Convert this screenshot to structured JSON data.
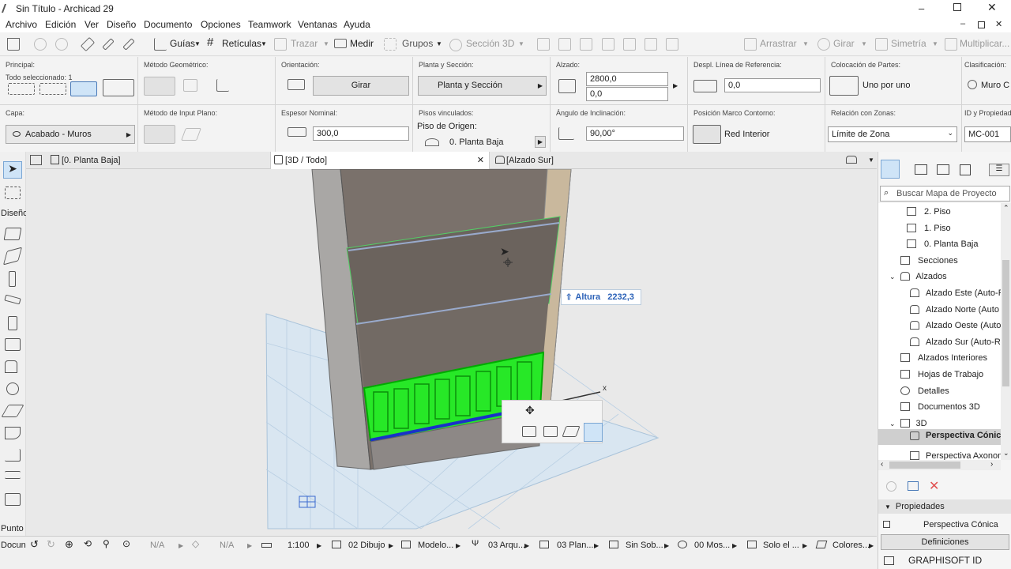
{
  "window": {
    "title": "Sin Título - Archicad 29"
  },
  "menu": [
    "Archivo",
    "Edición",
    "Ver",
    "Diseño",
    "Documento",
    "Opciones",
    "Teamwork",
    "Ventanas",
    "Ayuda"
  ],
  "toolbar": {
    "guias": "Guías",
    "reticulas": "Retículas",
    "trazar": "Trazar",
    "medir": "Medir",
    "grupos": "Grupos",
    "seccion3d": "Sección 3D",
    "arrastrar": "Arrastrar",
    "girar": "Girar",
    "simetria": "Simetría",
    "multiplicar": "Multiplicar..."
  },
  "infobox": {
    "principal": {
      "label": "Principal:",
      "sub": "Todo seleccionado: 1"
    },
    "metodo_geometrico": {
      "label": "Método Geométrico:"
    },
    "orientacion": {
      "label": "Orientación:",
      "button": "Girar"
    },
    "planta_seccion": {
      "label": "Planta y Sección:",
      "value": "Planta y Sección"
    },
    "alzado": {
      "label": "Alzado:",
      "top": "2800,0",
      "bottom": "0,0"
    },
    "despl": {
      "label": "Despl. Línea de Referencia:",
      "value": "0,0"
    },
    "colocacion": {
      "label": "Colocación de Partes:",
      "value": "Uno por uno"
    },
    "clasificacion": {
      "label": "Clasificación:",
      "value": "Muro C"
    },
    "capa": {
      "label": "Capa:",
      "value": "Acabado - Muros"
    },
    "metodo_input": {
      "label": "Método de Input Plano:"
    },
    "espesor": {
      "label": "Espesor Nominal:",
      "value": "300,0"
    },
    "pisos": {
      "label": "Pisos vinculados:",
      "sub": "Piso de Origen:",
      "value": "0. Planta Baja"
    },
    "angulo": {
      "label": "Ángulo de Inclinación:",
      "value": "90,00°"
    },
    "marco": {
      "label": "Posición Marco Contorno:",
      "value": "Red Interior"
    },
    "zonas": {
      "label": "Relación con Zonas:",
      "value": "Límite de Zona"
    },
    "id": {
      "label": "ID y Propiedades",
      "value": "MC-001"
    }
  },
  "tabs": {
    "t1": "[0. Planta Baja]",
    "t2": "[3D / Todo]",
    "t3": "[Alzado Sur]"
  },
  "left_tools": {
    "diseno": "Diseño",
    "punto": "Punto",
    "docum": "Docun"
  },
  "viewport": {
    "tooltip_label": "Altura",
    "tooltip_value": "2232,3",
    "axis": "x"
  },
  "statusbar": {
    "na1": "N/A",
    "na2": "N/A",
    "scale": "1:100",
    "dibujo": "02 Dibujo",
    "modelo": "Modelo...",
    "arq": "03 Arqu...",
    "plan": "03 Plan...",
    "sinsob": "Sin Sob...",
    "mos": "00 Mos...",
    "solo": "Solo el ...",
    "colores": "Colores..."
  },
  "navigator": {
    "search_placeholder": "Buscar Mapa de Proyecto",
    "items": [
      "2. Piso",
      "1. Piso",
      "0. Planta Baja",
      "Secciones",
      "Alzados",
      "Alzado Este (Auto-R",
      "Alzado Norte (Auto",
      "Alzado Oeste (Auto",
      "Alzado Sur (Auto-R",
      "Alzados Interiores",
      "Hojas de Trabajo",
      "Detalles",
      "Documentos 3D",
      "3D",
      "Perspectiva Cónica",
      "Perspectiva Axonom"
    ],
    "propiedades": "Propiedades",
    "prop_value": "Perspectiva Cónica",
    "definiciones": "Definiciones",
    "brand": "GRAPHISOFT ID"
  }
}
